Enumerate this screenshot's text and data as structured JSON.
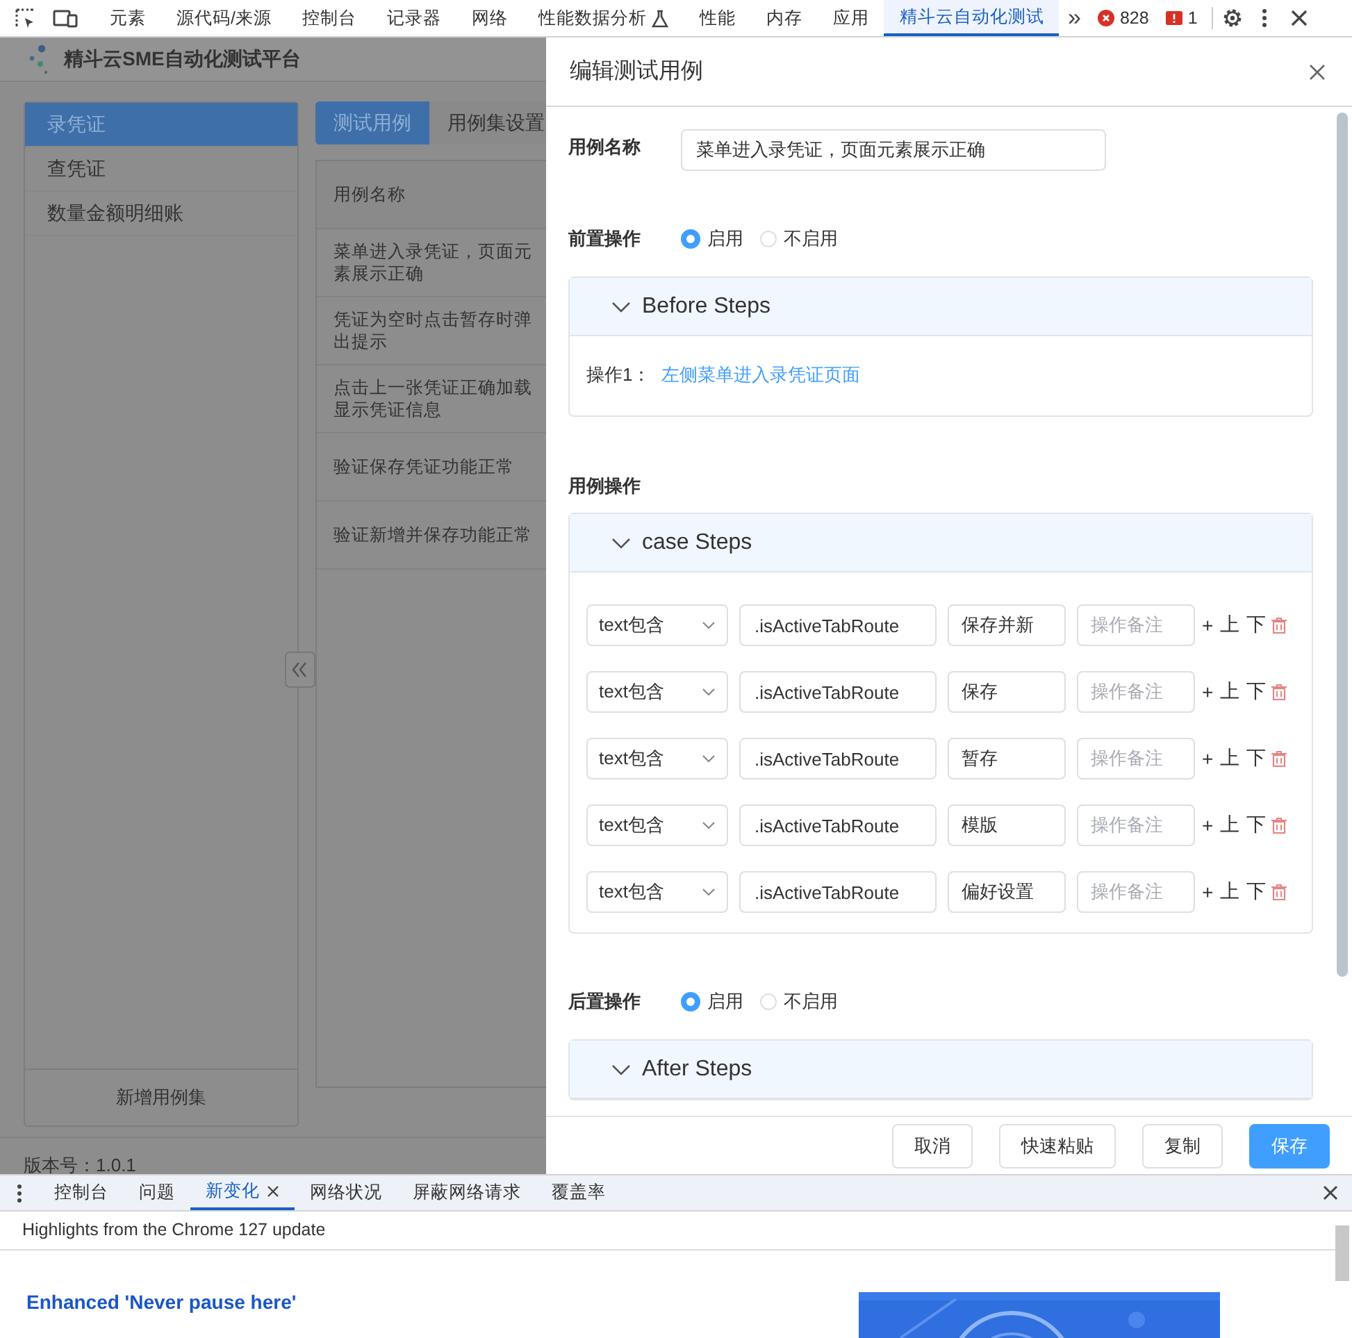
{
  "devtools": {
    "tabs": [
      {
        "label": "元素",
        "selected": false
      },
      {
        "label": "源代码/来源",
        "selected": false
      },
      {
        "label": "控制台",
        "selected": false
      },
      {
        "label": "记录器",
        "selected": false
      },
      {
        "label": "网络",
        "selected": false
      },
      {
        "label": "性能数据分析",
        "selected": false,
        "kind": "flask"
      },
      {
        "label": "性能",
        "selected": false
      },
      {
        "label": "内存",
        "selected": false
      },
      {
        "label": "应用",
        "selected": false
      },
      {
        "label": "精斗云自动化测试",
        "selected": true
      }
    ],
    "more": "»",
    "errors": "828",
    "issues": "1"
  },
  "app": {
    "title": "精斗云SME自动化测试平台",
    "sidebar": {
      "items": [
        {
          "label": "录凭证",
          "selected": true
        },
        {
          "label": "查凭证",
          "selected": false
        },
        {
          "label": "数量金额明细账",
          "selected": false
        }
      ],
      "add_button": "新增用例集"
    },
    "tabs": [
      {
        "label": "测试用例",
        "selected": true
      },
      {
        "label": "用例集设置",
        "selected": false
      }
    ],
    "table": {
      "columns": [
        "用例名称"
      ],
      "rows": [
        "菜单进入录凭证，页面元素展示正确",
        "凭证为空时点击暂存时弹出提示",
        "点击上一张凭证正确加载显示凭证信息",
        "验证保存凭证功能正常",
        "验证新增并保存功能正常"
      ]
    },
    "version": "版本号：1.0.1"
  },
  "drawer": {
    "title": "编辑测试用例",
    "case_name": {
      "label": "用例名称",
      "value": "菜单进入录凭证，页面元素展示正确"
    },
    "before": {
      "label": "前置操作",
      "options": [
        {
          "label": "启用",
          "selected": true
        },
        {
          "label": "不启用",
          "selected": false
        }
      ],
      "panel": {
        "title": "Before Steps",
        "expanded": true,
        "steps": [
          {
            "label": "操作1：",
            "link": "左侧菜单进入录凭证页面"
          }
        ]
      }
    },
    "case_ops": {
      "label": "用例操作",
      "panel": {
        "title": "case Steps",
        "expanded": true,
        "rows": [
          {
            "type": "text包含",
            "selector": ".isActiveTabRoute",
            "value": "保存并新",
            "note_placeholder": "操作备注",
            "add": "+",
            "up": "上",
            "down": "下"
          },
          {
            "type": "text包含",
            "selector": ".isActiveTabRoute",
            "value": "保存",
            "note_placeholder": "操作备注",
            "add": "+",
            "up": "上",
            "down": "下"
          },
          {
            "type": "text包含",
            "selector": ".isActiveTabRoute",
            "value": "暂存",
            "note_placeholder": "操作备注",
            "add": "+",
            "up": "上",
            "down": "下"
          },
          {
            "type": "text包含",
            "selector": ".isActiveTabRoute",
            "value": "模版",
            "note_placeholder": "操作备注",
            "add": "+",
            "up": "上",
            "down": "下"
          },
          {
            "type": "text包含",
            "selector": ".isActiveTabRoute",
            "value": "偏好设置",
            "note_placeholder": "操作备注",
            "add": "+",
            "up": "上",
            "down": "下"
          }
        ]
      }
    },
    "after": {
      "label": "后置操作",
      "options": [
        {
          "label": "启用",
          "selected": true
        },
        {
          "label": "不启用",
          "selected": false
        }
      ],
      "panel": {
        "title": "After Steps",
        "expanded": true
      }
    },
    "buttons": [
      {
        "label": "取消",
        "kind": "default"
      },
      {
        "label": "快速粘贴",
        "kind": "default"
      },
      {
        "label": "复制",
        "kind": "default"
      },
      {
        "label": "保存",
        "kind": "primary"
      }
    ]
  },
  "bottom": {
    "tabs": [
      {
        "label": "控制台",
        "selected": false,
        "closable": false
      },
      {
        "label": "问题",
        "selected": false,
        "closable": false
      },
      {
        "label": "新变化",
        "selected": true,
        "closable": true
      },
      {
        "label": "网络状况",
        "selected": false,
        "closable": false
      },
      {
        "label": "屏蔽网络请求",
        "selected": false,
        "closable": false
      },
      {
        "label": "覆盖率",
        "selected": false,
        "closable": false
      }
    ],
    "heading": "Highlights from the Chrome 127 update",
    "feature_title": "Enhanced 'Never pause here'"
  }
}
